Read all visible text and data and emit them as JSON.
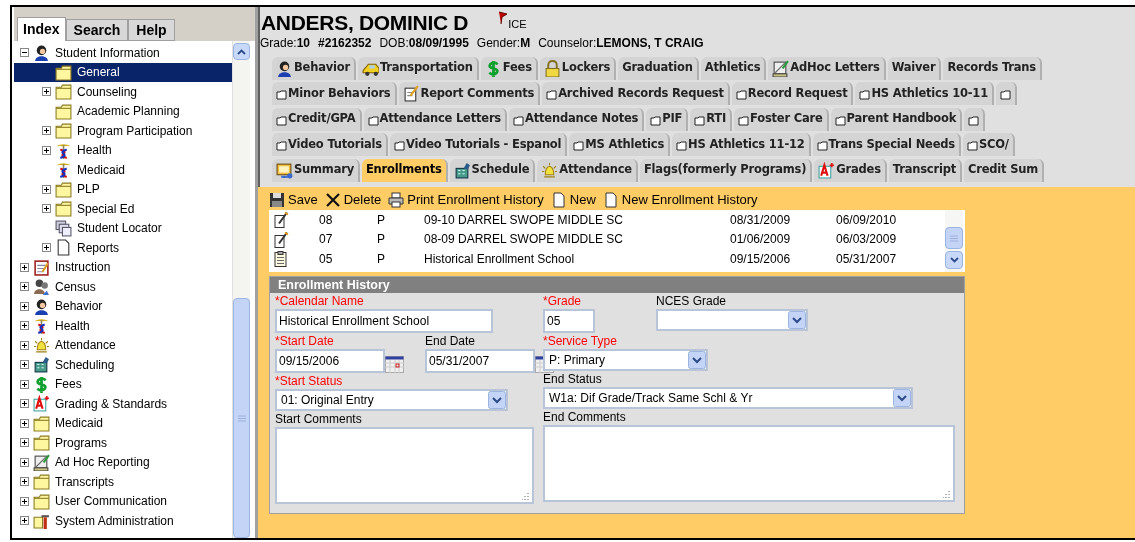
{
  "sidebar": {
    "tabs": [
      {
        "label": "Index",
        "selected": true
      },
      {
        "label": "Search",
        "selected": false
      },
      {
        "label": "Help",
        "selected": false
      }
    ],
    "tree": [
      {
        "label": "Student Information",
        "kind": "student",
        "expandable": true,
        "expanded": true,
        "selected": false,
        "children": [
          {
            "label": "General",
            "kind": "folder",
            "expandable": false,
            "selected": true
          },
          {
            "label": "Counseling",
            "kind": "folder",
            "expandable": true,
            "expanded": false,
            "selected": false
          },
          {
            "label": "Academic Planning",
            "kind": "folder",
            "expandable": false,
            "selected": false
          },
          {
            "label": "Program Participation",
            "kind": "folder",
            "expandable": true,
            "expanded": false,
            "selected": false
          },
          {
            "label": "Health",
            "kind": "caduceus",
            "expandable": true,
            "expanded": false,
            "selected": false
          },
          {
            "label": "Medicaid",
            "kind": "caduceus",
            "expandable": false,
            "selected": false
          },
          {
            "label": "PLP",
            "kind": "folder",
            "expandable": true,
            "expanded": false,
            "selected": false
          },
          {
            "label": "Special Ed",
            "kind": "folder",
            "expandable": true,
            "expanded": false,
            "selected": false
          },
          {
            "label": "Student Locator",
            "kind": "locator",
            "expandable": false,
            "selected": false
          },
          {
            "label": "Reports",
            "kind": "page",
            "expandable": true,
            "expanded": false,
            "selected": false
          }
        ]
      },
      {
        "label": "Instruction",
        "kind": "notebook",
        "expandable": true,
        "expanded": false,
        "selected": false
      },
      {
        "label": "Census",
        "kind": "census",
        "expandable": true,
        "expanded": false,
        "selected": false
      },
      {
        "label": "Behavior",
        "kind": "student",
        "expandable": true,
        "expanded": false,
        "selected": false
      },
      {
        "label": "Health",
        "kind": "caduceus",
        "expandable": true,
        "expanded": false,
        "selected": false
      },
      {
        "label": "Attendance",
        "kind": "bell",
        "expandable": true,
        "expanded": false,
        "selected": false
      },
      {
        "label": "Scheduling",
        "kind": "building",
        "expandable": true,
        "expanded": false,
        "selected": false
      },
      {
        "label": "Fees",
        "kind": "dollar",
        "expandable": true,
        "expanded": false,
        "selected": false
      },
      {
        "label": "Grading & Standards",
        "kind": "grade",
        "expandable": true,
        "expanded": false,
        "selected": false
      },
      {
        "label": "Medicaid",
        "kind": "folder",
        "expandable": true,
        "expanded": false,
        "selected": false
      },
      {
        "label": "Programs",
        "kind": "folder",
        "expandable": true,
        "expanded": false,
        "selected": false
      },
      {
        "label": "Ad Hoc Reporting",
        "kind": "chart",
        "expandable": true,
        "expanded": false,
        "selected": false
      },
      {
        "label": "Transcripts",
        "kind": "folder",
        "expandable": true,
        "expanded": false,
        "selected": false
      },
      {
        "label": "User Communication",
        "kind": "folder",
        "expandable": true,
        "expanded": false,
        "selected": false
      },
      {
        "label": "System Administration",
        "kind": "tools",
        "expandable": true,
        "expanded": false,
        "selected": false
      }
    ]
  },
  "header": {
    "name": "ANDERS, DOMINIC D",
    "flag": "ICE",
    "details": [
      "Grade:**10**",
      "**#2162352**",
      "DOB:**08/09/1995**",
      "Gender:**M**",
      "Counselor:**LEMONS, T CRAIG**"
    ]
  },
  "tab_rows": [
    [
      {
        "label": "Behavior",
        "kind": "student",
        "selected": false
      },
      {
        "label": "Transportation",
        "kind": "bus",
        "selected": false
      },
      {
        "label": "Fees",
        "kind": "dollar",
        "selected": false
      },
      {
        "label": "Lockers",
        "kind": "lock",
        "selected": false
      },
      {
        "label": "Graduation",
        "kind": "plain",
        "selected": false
      },
      {
        "label": "Athletics",
        "kind": "plain",
        "selected": false
      },
      {
        "label": "AdHoc Letters",
        "kind": "chart",
        "selected": false
      },
      {
        "label": "Waiver",
        "kind": "plain",
        "selected": false
      },
      {
        "label": "Records Trans",
        "kind": "plain",
        "selected": false
      }
    ],
    [
      {
        "label": "Minor Behaviors",
        "kind": "tabpage",
        "selected": false
      },
      {
        "label": "Report Comments",
        "kind": "note",
        "selected": false
      },
      {
        "label": "Archived Records Request",
        "kind": "tabpage",
        "selected": false
      },
      {
        "label": "Record Request",
        "kind": "tabpage",
        "selected": false
      },
      {
        "label": "HS Athletics 10-11",
        "kind": "tabpage",
        "selected": false
      },
      {
        "kind": "tabpage",
        "selected": false
      }
    ],
    [
      {
        "label": "Credit/GPA",
        "kind": "tabpage",
        "selected": false
      },
      {
        "label": "Attendance Letters",
        "kind": "tabpage",
        "selected": false
      },
      {
        "label": "Attendance Notes",
        "kind": "tabpage",
        "selected": false
      },
      {
        "label": "PIF",
        "kind": "tabpage",
        "selected": false
      },
      {
        "label": "RTI",
        "kind": "tabpage",
        "selected": false
      },
      {
        "label": "Foster Care",
        "kind": "tabpage",
        "selected": false
      },
      {
        "label": "Parent Handbook",
        "kind": "tabpage",
        "selected": false
      },
      {
        "kind": "tabpage",
        "selected": false
      }
    ],
    [
      {
        "label": "Video Tutorials",
        "kind": "tabpage",
        "selected": false
      },
      {
        "label": "Video Tutorials - Espanol",
        "kind": "tabpage",
        "selected": false
      },
      {
        "label": "MS Athletics",
        "kind": "tabpage",
        "selected": false
      },
      {
        "label": "HS Athletics 11-12",
        "kind": "tabpage",
        "selected": false
      },
      {
        "label": "Trans Special Needs",
        "kind": "tabpage",
        "selected": false
      },
      {
        "label": "SCO/",
        "kind": "tabpage",
        "selected": false
      }
    ],
    [
      {
        "label": "Summary",
        "kind": "summary",
        "selected": false
      },
      {
        "label": "Enrollments",
        "kind": "plain",
        "selected": true
      },
      {
        "label": "Schedule",
        "kind": "building",
        "selected": false
      },
      {
        "label": "Attendance",
        "kind": "bell",
        "selected": false
      },
      {
        "label": "Flags(formerly Programs)",
        "kind": "plain",
        "selected": false
      },
      {
        "label": "Grades",
        "kind": "grade",
        "selected": false
      },
      {
        "label": "Transcript",
        "kind": "plain",
        "selected": false
      },
      {
        "label": "Credit Sum",
        "kind": "plain",
        "selected": false
      }
    ]
  ],
  "toolbar": [
    {
      "label": "Save",
      "kind": "save"
    },
    {
      "label": "Delete",
      "kind": "delete"
    },
    {
      "label": "Print Enrollment History",
      "kind": "printer"
    },
    {
      "label": "New",
      "kind": "page"
    },
    {
      "label": "New Enrollment History",
      "kind": "page"
    }
  ],
  "enrollments": [
    {
      "kind": "edit",
      "cells": [
        "08",
        "P",
        "09-10 DARREL SWOPE MIDDLE SC",
        "08/31/2009",
        "06/09/2010"
      ]
    },
    {
      "kind": "edit",
      "cells": [
        "07",
        "P",
        "08-09 DARREL SWOPE MIDDLE SC",
        "01/06/2009",
        "06/03/2009"
      ]
    },
    {
      "kind": "clipboard",
      "cells": [
        "05",
        "P",
        "Historical Enrollment School",
        "09/15/2006",
        "05/31/2007"
      ]
    }
  ],
  "form": {
    "title": "Enrollment History",
    "left": [
      [
        {
          "label": "*Calendar Name",
          "required": true,
          "kind": "text",
          "value": "Historical Enrollment School"
        }
      ],
      [
        {
          "label": "*Start Date",
          "required": true,
          "kind": "date",
          "value": "09/15/2006"
        },
        {
          "label": "End Date",
          "required": false,
          "kind": "date",
          "value": "05/31/2007"
        }
      ],
      [
        {
          "label": "*Start Status",
          "required": true,
          "kind": "select",
          "value": "01: Original Entry"
        }
      ],
      [
        {
          "label": "Start Comments",
          "required": false,
          "kind": "textarea"
        }
      ]
    ],
    "right": [
      [
        {
          "label": "*Grade",
          "required": true,
          "kind": "text",
          "value": "05"
        },
        {
          "label": "NCES Grade",
          "required": false,
          "kind": "select"
        }
      ],
      [
        {
          "label": "*Service Type",
          "required": true,
          "kind": "select",
          "value": "P: Primary"
        }
      ],
      [
        {
          "label": "End Status",
          "required": false,
          "kind": "select",
          "value": "W1a: Dif Grade/Track Same Schl & Yr"
        }
      ],
      [
        {
          "label": "End Comments",
          "required": false,
          "kind": "textarea"
        }
      ]
    ]
  }
}
